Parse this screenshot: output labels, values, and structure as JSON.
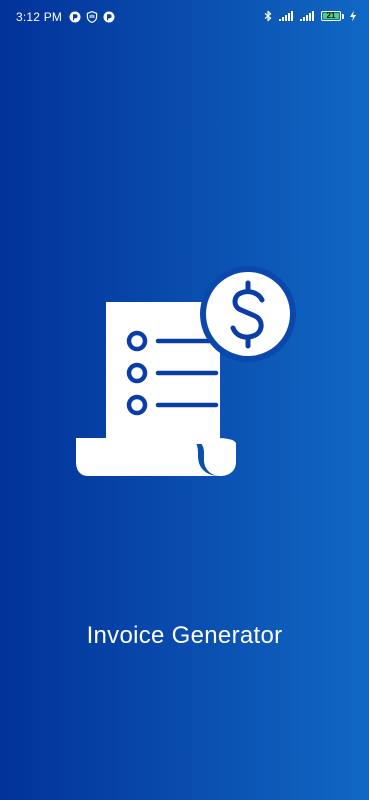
{
  "status_bar": {
    "time": "3:12 PM",
    "notification_icons": [
      "app-notification-icon",
      "shield-notification-icon",
      "app-notification-icon"
    ],
    "system_icons": [
      "bluetooth-icon",
      "signal-icon",
      "signal-icon",
      "battery-icon",
      "charging-icon"
    ],
    "battery_level": "21"
  },
  "splash": {
    "logo_icon": "invoice-receipt-dollar-icon",
    "title": "Invoice Generator"
  },
  "colors": {
    "gradient_start": "#02329a",
    "gradient_end": "#1168c4",
    "foreground": "#ffffff",
    "battery_fill": "#4fd26a"
  }
}
